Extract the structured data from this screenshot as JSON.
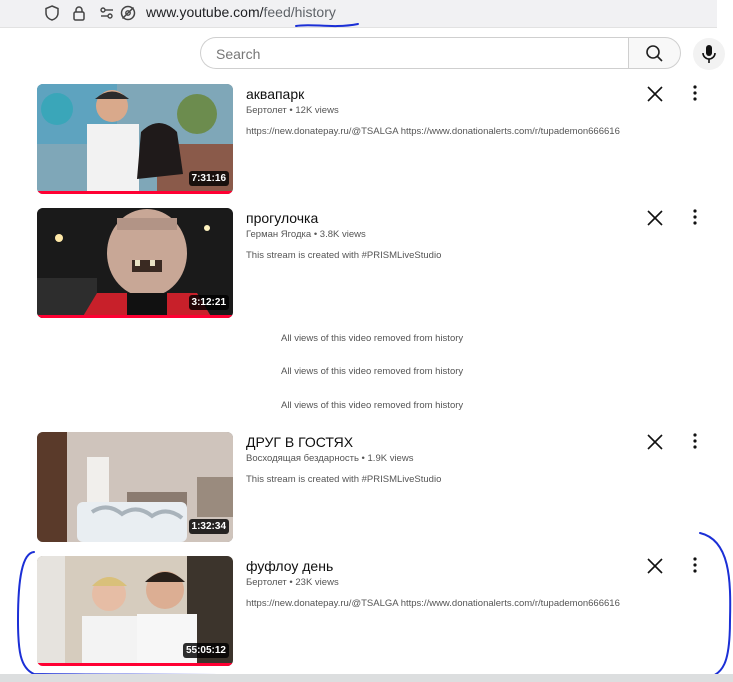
{
  "browser": {
    "url_domain": "www.youtube.com/",
    "url_path": "feed/history"
  },
  "search": {
    "placeholder": "Search"
  },
  "videos": [
    {
      "title": "аквапарк",
      "channel": "Бертолет",
      "views": "12K views",
      "description": "https://new.donatepay.ru/@TSALGA https://www.donationalerts.com/r/tupademon666616",
      "duration": "7:31:16"
    },
    {
      "title": "прогулочка",
      "channel": "Герман Ягодка",
      "views": "3.8K views",
      "description": "This stream is created with #PRISMLiveStudio",
      "duration": "3:12:21"
    },
    {
      "title": "ДРУГ В ГОСТЯХ",
      "channel": "Восходящая бездарность",
      "views": "1.9K views",
      "description": "This stream is created with #PRISMLiveStudio",
      "duration": "1:32:34"
    },
    {
      "title": "фуфлоу день",
      "channel": "Бертолет",
      "views": "23K views",
      "description": "https://new.donatepay.ru/@TSALGA https://www.donationalerts.com/r/tupademon666616",
      "duration": "55:05:12"
    }
  ],
  "removed_messages": [
    "All views of this video removed from history",
    "All views of this video removed from history",
    "All views of this video removed from history"
  ],
  "separator": "•",
  "colors": {
    "progress": "#ff0033",
    "annotation": "#1b2fd6"
  }
}
